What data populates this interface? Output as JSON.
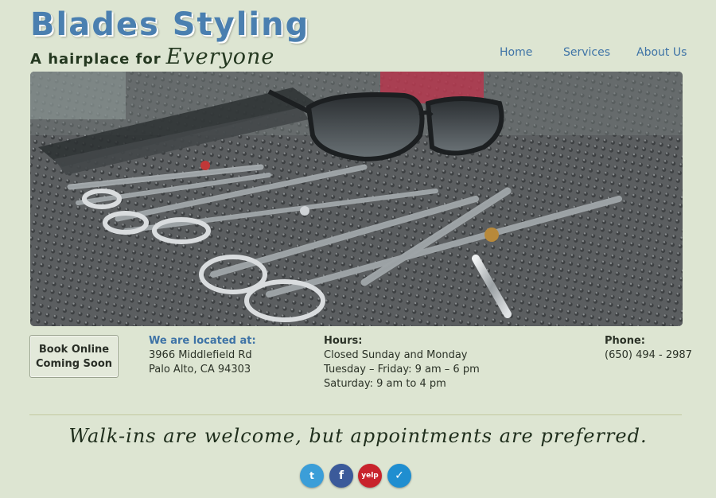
{
  "brand": {
    "title": "Blades Styling",
    "tagline_plain": "A hairplace for",
    "tagline_script": "Everyone",
    "title_color": "#4a7fb0"
  },
  "nav": {
    "items": [
      {
        "label": "Home"
      },
      {
        "label": "Services"
      },
      {
        "label": "About Us"
      }
    ],
    "link_color": "#3e73a6"
  },
  "hero": {
    "icon": "salon-tools-photo"
  },
  "book": {
    "line1": "Book Online",
    "line2": "Coming Soon"
  },
  "location": {
    "heading": "We are located at:",
    "street": "3966 Middlefield Rd",
    "city": "Palo Alto, CA 94303"
  },
  "hours": {
    "heading": "Hours:",
    "line1": "Closed Sunday and Monday",
    "line2": "Tuesday – Friday: 9 am – 6 pm",
    "line3": "Saturday: 9 am to 4 pm"
  },
  "phone": {
    "heading": "Phone:",
    "number": "(650) 494 - 2987"
  },
  "motto": "Walk-ins are welcome, but appointments are preferred.",
  "social": {
    "twitter": {
      "icon": "twitter-icon",
      "glyph": "t",
      "color": "#3b9ed8"
    },
    "facebook": {
      "icon": "facebook-icon",
      "glyph": "f",
      "color": "#3b5a9a"
    },
    "yelp": {
      "icon": "yelp-icon",
      "glyph": "yelp",
      "color": "#c8232c"
    },
    "foursquare": {
      "icon": "foursquare-icon",
      "glyph": "✓",
      "color": "#1f8ed0"
    }
  },
  "background_color": "#dde5d2"
}
